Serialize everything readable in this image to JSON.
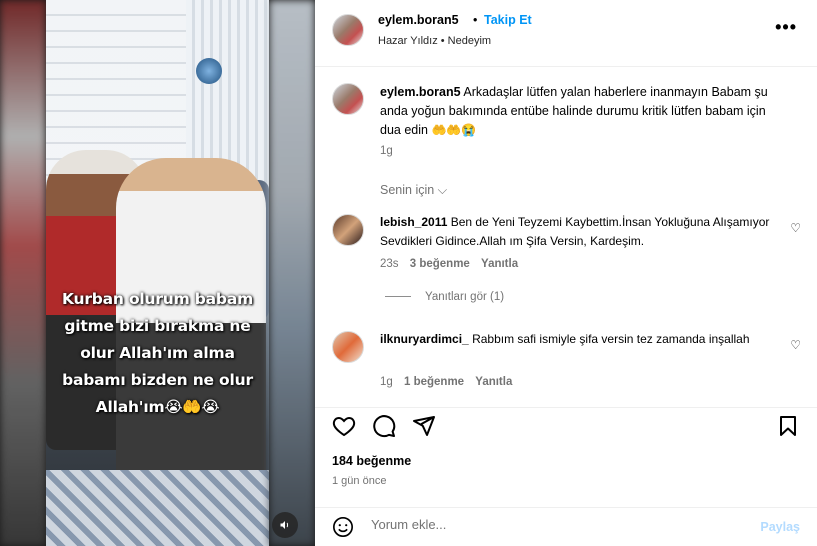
{
  "media": {
    "caption": "Kurban olurum babam gitme bizi bırakma ne olur Allah'ım alma babamı bizden ne olur Allah'ım😭🤲😭",
    "mute_icon": "speaker-icon"
  },
  "header": {
    "username": "eylem.boran5",
    "separator": "•",
    "follow_label": "Takip Et",
    "subtitle": "Hazar Yıldız • Nedeyim",
    "more_label": "•••"
  },
  "main_comment": {
    "username": "eylem.boran5",
    "text": "Arkadaşlar lütfen yalan haberlere inanmayın Babam şu anda yoğun bakımında entübe halinde durumu kritik lütfen babam için dua edin",
    "emojis": "🤲🤲😭",
    "time": "1g"
  },
  "filter_label": "Senin için ⌵",
  "comments": [
    {
      "username": "lebish_2011",
      "text": "Ben de Yeni Teyzemi Kaybettim.İnsan Yokluğuna Alışamıyor Sevdikleri Gidince.Allah ım Şifa Versin, Kardeşim.",
      "time": "23s",
      "likes": "3 beğenme",
      "reply": "Yanıtla",
      "view_replies": "Yanıtları gör (1)"
    },
    {
      "username": "ilknuryardimci_",
      "text": "Rabbım safi ismiyle şifa versin tez zamanda inşallah",
      "time": "1g",
      "likes": "1 beğenme",
      "reply": "Yanıtla"
    }
  ],
  "actions": {
    "like_count": "184 beğenme",
    "posted": "1 gün önce"
  },
  "composer": {
    "placeholder": "Yorum ekle...",
    "share_label": "Paylaş"
  },
  "colors": {
    "link_blue": "#0095f6",
    "share_disabled": "#b3dbff",
    "muted_text": "#737373"
  }
}
